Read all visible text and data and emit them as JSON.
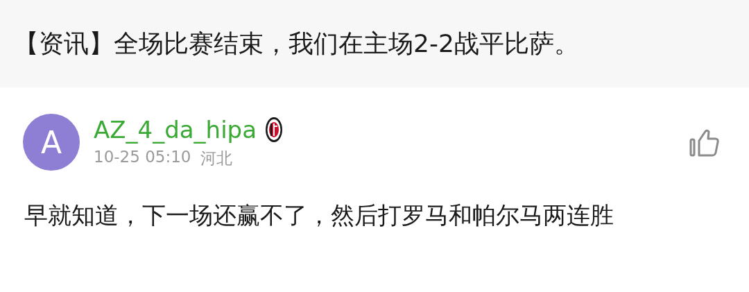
{
  "headline": "【资讯】全场比赛结束，我们在主场2-2战平比萨。",
  "comment": {
    "avatar_letter": "A",
    "username": "AZ_4_da_hipa",
    "time": "10-25 05:10",
    "location": "河北",
    "text": "早就知道，下一场还赢不了，然后打罗马和帕尔马两连胜"
  }
}
